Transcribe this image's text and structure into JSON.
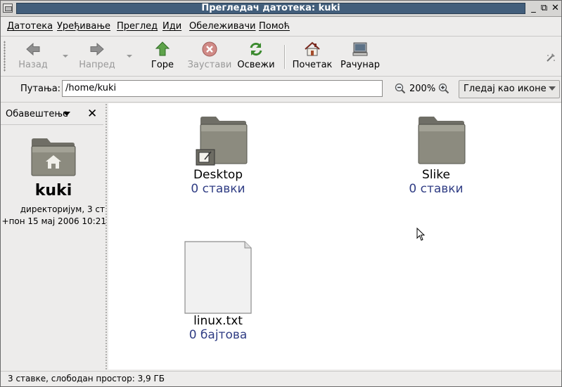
{
  "window": {
    "title": "Прегледач датотека: kuki",
    "controls": [
      "_",
      "⧉",
      "✕"
    ]
  },
  "menubar": [
    "Датотека",
    "Уређивање",
    "Преглед",
    "Иди",
    "Обележивачи",
    "Помоћ"
  ],
  "toolbar": {
    "back": "Назад",
    "forward": "Напред",
    "up": "Горе",
    "stop": "Заустави",
    "reload": "Освежи",
    "home": "Почетак",
    "computer": "Рачунар"
  },
  "location": {
    "label": "Путања:",
    "value": "/home/kuki",
    "zoom": "200%",
    "view_mode": "Гледај као иконе"
  },
  "sidebar": {
    "title": "Обавештење",
    "name": "kuki",
    "info_line1": "директоријум, 3 ст",
    "info_line2": "+пон 15 мај 2006 10:21"
  },
  "items": [
    {
      "name": "Desktop",
      "sub": "0 ставки",
      "type": "folder-emblem"
    },
    {
      "name": "Slike",
      "sub": "0 ставки",
      "type": "folder"
    },
    {
      "name": "linux.txt",
      "sub": "0 бајтова",
      "type": "file"
    }
  ],
  "status": "3 ставке, слободан простор: 3,9 ГБ",
  "colors": {
    "title_bar": "#425e7b",
    "item_subtitle": "#303d84"
  }
}
